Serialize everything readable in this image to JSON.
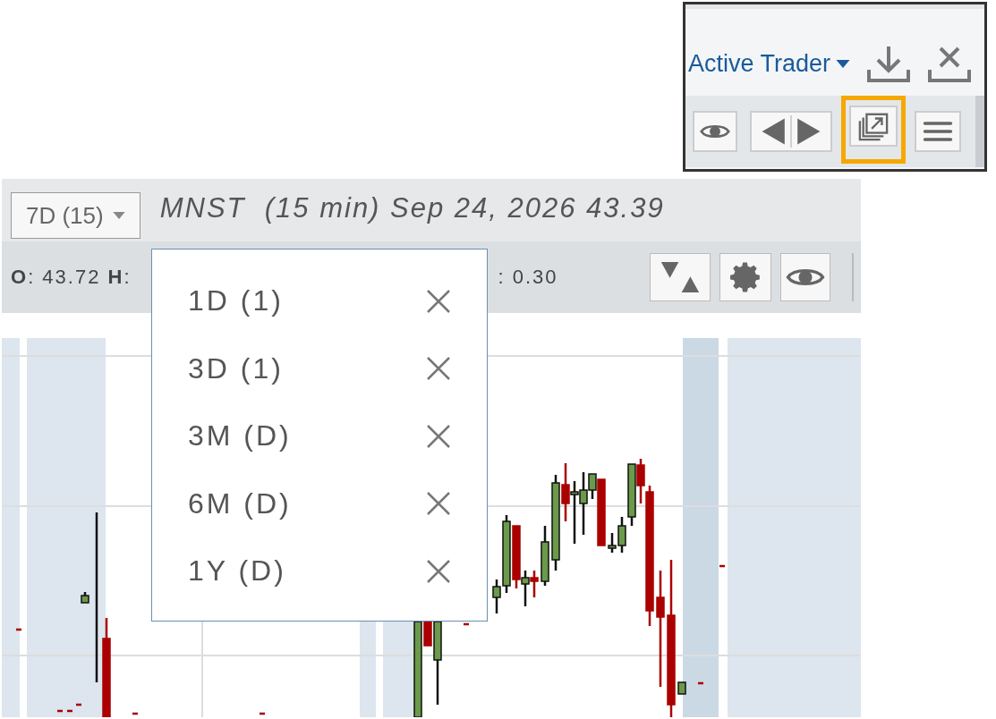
{
  "toolbar_inset": {
    "workspace_menu": "Active Trader",
    "buttons": [
      {
        "kind": "partial"
      },
      {
        "kind": "eye"
      },
      {
        "kind": "prev-next"
      },
      {
        "kind": "popout",
        "highlighted": true
      },
      {
        "kind": "menu"
      }
    ]
  },
  "chart_panel": {
    "timeframe": "7D (15)",
    "title": "MNST  (15 min) Sep 24, 2026 43.39",
    "ohlc_left": "**O**: 43.72 **H**:",
    "ohlc_right": ": 0.30",
    "timeframe_menu": [
      {
        "label": "1D (1)"
      },
      {
        "label": "3D (1)"
      },
      {
        "label": "3M (D)"
      },
      {
        "label": "6M (D)"
      },
      {
        "label": "1Y (D)"
      }
    ]
  }
}
